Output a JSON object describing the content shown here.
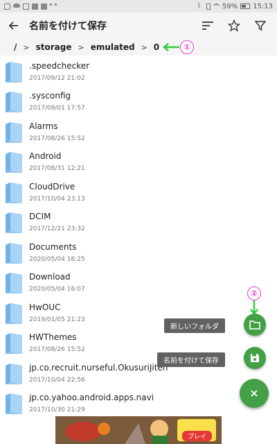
{
  "status_bar": {
    "battery": "59%",
    "time": "15:13"
  },
  "toolbar": {
    "title": "名前を付けて保存"
  },
  "breadcrumb": {
    "items": [
      "/",
      "storage",
      "emulated",
      "0"
    ],
    "separator": ">"
  },
  "annotations": {
    "marker1": "①",
    "marker2": "②"
  },
  "files": [
    {
      "name": ".speedchecker",
      "date": "2017/09/12 21:02"
    },
    {
      "name": ".sysconfig",
      "date": "2017/09/01 17:57"
    },
    {
      "name": "Alarms",
      "date": "2017/08/26 15:52"
    },
    {
      "name": "Android",
      "date": "2017/08/31 12:21"
    },
    {
      "name": "CloudDrive",
      "date": "2017/10/04 23:13"
    },
    {
      "name": "DCIM",
      "date": "2017/12/21 23:32"
    },
    {
      "name": "Documents",
      "date": "2020/05/04 16:25"
    },
    {
      "name": "Download",
      "date": "2020/05/04 16:07"
    },
    {
      "name": "HwOUC",
      "date": "2019/01/05 21:23"
    },
    {
      "name": "HWThemes",
      "date": "2017/08/26 15:52"
    },
    {
      "name": "jp.co.recruit.nurseful.OkusuriJiten",
      "date": "2017/10/04 22:56"
    },
    {
      "name": "jp.co.yahoo.android.apps.navi",
      "date": "2017/10/30 21:29"
    }
  ],
  "fab": {
    "new_folder_label": "新しいフォルダ",
    "save_label": "名前を付けて保存",
    "main_icon": "close-icon",
    "new_folder_icon": "folder-outline-icon",
    "save_icon": "floppy-icon"
  },
  "ad": {
    "play_label": "プレイ"
  },
  "colors": {
    "fab_green": "#43a047",
    "annotation_magenta": "#e040c8",
    "annotation_green": "#2ecc40",
    "folder_blue": "#a9d4f5",
    "label_bg": "#616161"
  }
}
